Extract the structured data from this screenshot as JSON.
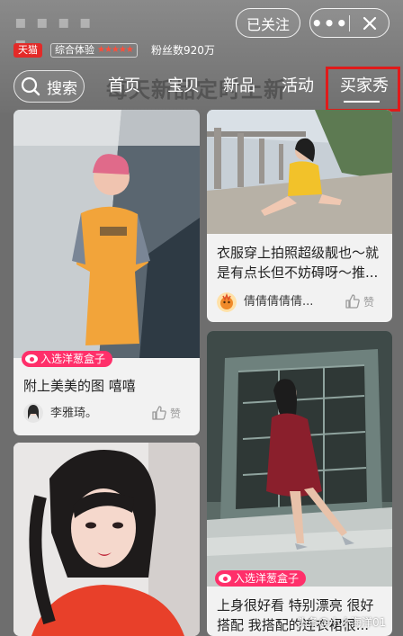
{
  "header": {
    "shop_name": "▪ ▪ ▪ ▪ ▪",
    "followed_label": "已关注",
    "more_label": "•••",
    "tmall_badge": "天猫",
    "experience_label": "综合体验",
    "experience_stars": "★★★★★",
    "experience_rating": 4,
    "fans_label": "粉丝数920万",
    "search_label": "搜索",
    "banner_text": "每天新品定时上新"
  },
  "tabs": [
    {
      "label": "首页",
      "active": false
    },
    {
      "label": "宝贝",
      "active": false
    },
    {
      "label": "新品",
      "active": false
    },
    {
      "label": "活动",
      "active": false
    },
    {
      "label": "买家秀",
      "active": true
    }
  ],
  "cards": [
    {
      "title": "附上美美的图 嘻嘻",
      "author": "李雅琦。",
      "like_label": "赞",
      "tag": "入选洋葱盒子"
    },
    {
      "title": "衣服穿上拍照超级靓也～就是有点长但不妨碍呀～推...",
      "author": "倩倩倩倩倩...",
      "like_label": "赞"
    },
    {
      "title": "上身很好看 特别漂亮 很好搭配 我搭配的连衣裙很...",
      "tag": "入选洋葱盒子"
    },
    {
      "title": ""
    }
  ],
  "watermark": "头条@小小海洋01",
  "colors": {
    "accent_red": "#e01a1a",
    "tag_pink": "#ff2f6a",
    "tmall_red": "#e32a28"
  }
}
